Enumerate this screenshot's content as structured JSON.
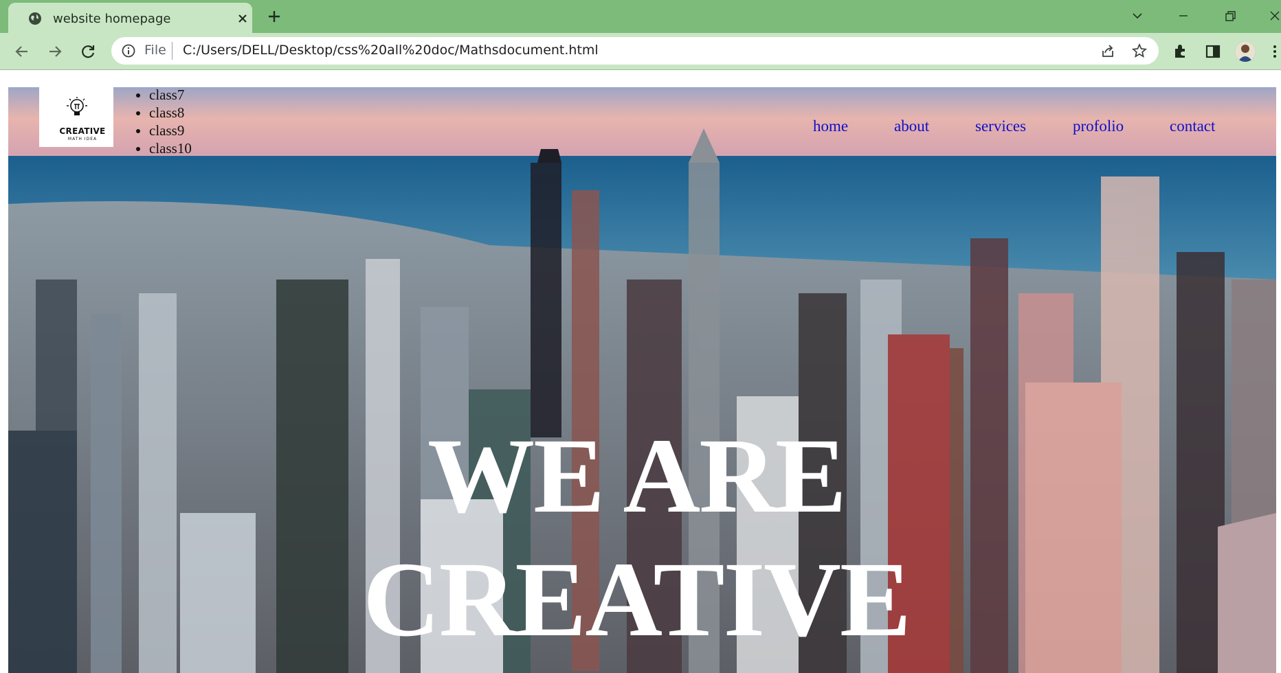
{
  "browser": {
    "tab_title": "website homepage",
    "url_scheme": "File",
    "url": "C:/Users/DELL/Desktop/css%20all%20doc/Mathsdocument.html",
    "icons": [
      "globe-icon",
      "close-icon",
      "plus-icon",
      "chevron-down-icon",
      "minimize-icon",
      "restore-icon",
      "close-window-icon",
      "back-icon",
      "forward-icon",
      "reload-icon",
      "info-icon",
      "share-icon",
      "star-icon",
      "extensions-icon",
      "side-panel-icon",
      "avatar",
      "more-icon"
    ]
  },
  "logo": {
    "title": "CREATIVE",
    "subtitle": "MATH IDEA"
  },
  "classes": [
    "class7",
    "class8",
    "class9",
    "class10"
  ],
  "nav": [
    "home",
    "about",
    "services",
    "profolio",
    "contact"
  ],
  "hero": {
    "line1": "WE ARE",
    "line2": "CREATIVE"
  },
  "colors": {
    "tabstrip": "#7cbb7a",
    "toolbar": "#c9e6c4",
    "nav_link": "#1010c8",
    "headline": "#ffffff"
  }
}
